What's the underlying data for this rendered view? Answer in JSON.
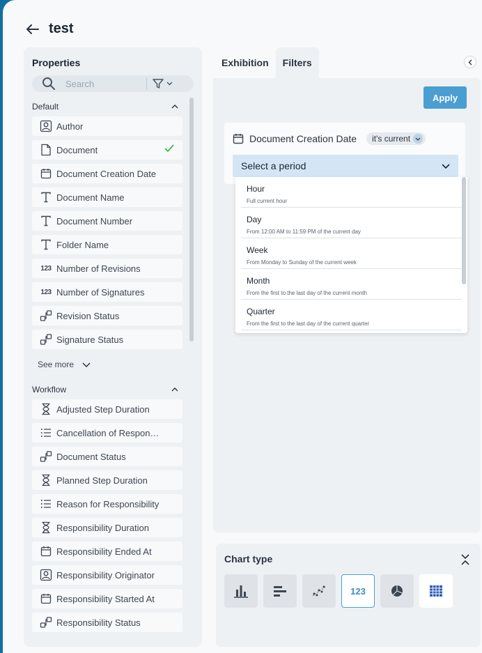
{
  "header": {
    "title": "test"
  },
  "properties": {
    "title": "Properties",
    "search_placeholder": "Search",
    "sections": [
      {
        "name": "Default",
        "items": [
          {
            "label": "Author",
            "icon": "user-icon"
          },
          {
            "label": "Document",
            "icon": "document-icon",
            "checked": true
          },
          {
            "label": "Document Creation Date",
            "icon": "calendar-icon"
          },
          {
            "label": "Document Name",
            "icon": "text-icon"
          },
          {
            "label": "Document Number",
            "icon": "text-icon"
          },
          {
            "label": "Folder Name",
            "icon": "text-icon"
          },
          {
            "label": "Number of Revisions",
            "icon": "number-icon"
          },
          {
            "label": "Number of Signatures",
            "icon": "number-icon"
          },
          {
            "label": "Revision Status",
            "icon": "status-icon"
          },
          {
            "label": "Signature Status",
            "icon": "status-icon"
          }
        ],
        "see_more": "See more"
      },
      {
        "name": "Workflow",
        "items": [
          {
            "label": "Adjusted Step Duration",
            "icon": "hourglass-icon"
          },
          {
            "label": "Cancellation of Responsi...",
            "icon": "list-icon"
          },
          {
            "label": "Document Status",
            "icon": "status-icon"
          },
          {
            "label": "Planned Step Duration",
            "icon": "hourglass-icon"
          },
          {
            "label": "Reason for Responsibility",
            "icon": "list-icon"
          },
          {
            "label": "Responsibility Duration",
            "icon": "hourglass-icon"
          },
          {
            "label": "Responsibility Ended At",
            "icon": "calendar-icon"
          },
          {
            "label": "Responsibility Originator",
            "icon": "user-icon"
          },
          {
            "label": "Responsibility Started At",
            "icon": "calendar-icon"
          },
          {
            "label": "Responsibility Status",
            "icon": "status-icon"
          }
        ]
      }
    ]
  },
  "tabs": [
    {
      "label": "Exhibition",
      "active": false
    },
    {
      "label": "Filters",
      "active": true
    }
  ],
  "filters": {
    "apply_label": "Apply",
    "filter": {
      "name": "Document Creation Date",
      "condition": "it's current",
      "select_placeholder": "Select a period",
      "options": [
        {
          "label": "Hour",
          "desc": "Full current hour"
        },
        {
          "label": "Day",
          "desc": "From 12:00 AM to 11:59 PM of the current day"
        },
        {
          "label": "Week",
          "desc": "From Monday to Sunday of the current week"
        },
        {
          "label": "Month",
          "desc": "From the first to the last day of the current month"
        },
        {
          "label": "Quarter",
          "desc": "From the first to the last day of the current quarter"
        }
      ]
    }
  },
  "chart_type": {
    "title": "Chart type",
    "options": [
      {
        "name": "vertical-bar-chart-icon"
      },
      {
        "name": "horizontal-bar-chart-icon"
      },
      {
        "name": "scatter-chart-icon"
      },
      {
        "name": "number-chart-icon",
        "label": "123",
        "selected": true
      },
      {
        "name": "pie-chart-icon"
      },
      {
        "name": "table-chart-icon"
      }
    ]
  },
  "colors": {
    "accent": "#4a9ed2",
    "check": "#4caf50",
    "frame": "#0e6fa0"
  }
}
